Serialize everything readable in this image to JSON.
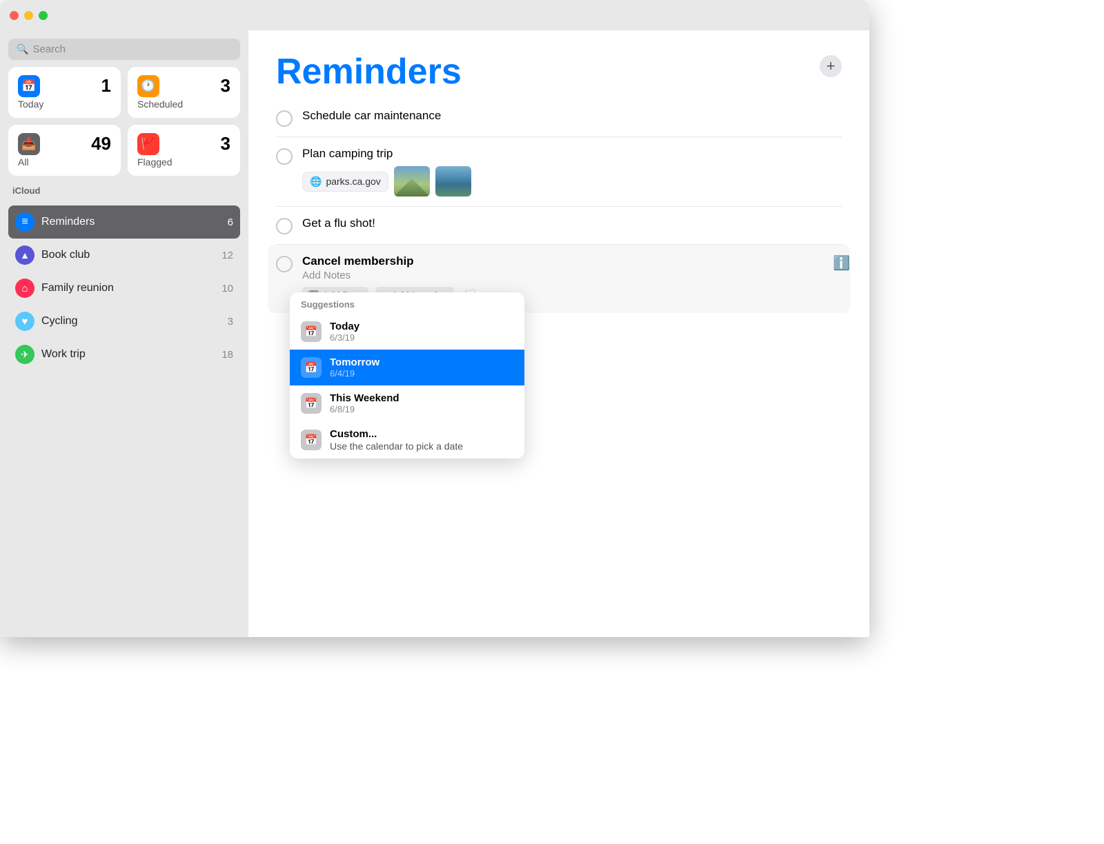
{
  "titlebar": {
    "lights": [
      "red",
      "yellow",
      "green"
    ]
  },
  "sidebar": {
    "search_placeholder": "Search",
    "tiles": [
      {
        "id": "today",
        "label": "Today",
        "count": "1",
        "icon": "📅",
        "icon_style": "blue"
      },
      {
        "id": "scheduled",
        "label": "Scheduled",
        "count": "3",
        "icon": "🕐",
        "icon_style": "orange"
      },
      {
        "id": "all",
        "label": "All",
        "count": "49",
        "icon": "📥",
        "icon_style": "gray"
      },
      {
        "id": "flagged",
        "label": "Flagged",
        "count": "3",
        "icon": "🚩",
        "icon_style": "red"
      }
    ],
    "section_label": "iCloud",
    "lists": [
      {
        "id": "reminders",
        "name": "Reminders",
        "count": "6",
        "icon_style": "li-blue",
        "icon": "≡",
        "active": true
      },
      {
        "id": "bookclub",
        "name": "Book club",
        "count": "12",
        "icon_style": "li-purple",
        "icon": "▲"
      },
      {
        "id": "familyreunion",
        "name": "Family reunion",
        "count": "10",
        "icon_style": "li-pink",
        "icon": "⌂"
      },
      {
        "id": "cycling",
        "name": "Cycling",
        "count": "3",
        "icon_style": "li-lightblue",
        "icon": "♥"
      },
      {
        "id": "worktrip",
        "name": "Work trip",
        "count": "18",
        "icon_style": "li-green",
        "icon": "✈"
      }
    ]
  },
  "main": {
    "title": "Reminders",
    "add_button_label": "+",
    "reminders": [
      {
        "id": "r1",
        "title": "Schedule car maintenance",
        "notes": "",
        "attachments": []
      },
      {
        "id": "r2",
        "title": "Plan camping trip",
        "notes": "",
        "attachments": [
          "link",
          "thumb1",
          "thumb2"
        ]
      },
      {
        "id": "r3",
        "title": "Get a flu shot!",
        "notes": "",
        "attachments": []
      },
      {
        "id": "r4",
        "title": "Cancel membership",
        "notes": "Add Notes",
        "editing": true,
        "attachments": []
      }
    ],
    "add_date_label": "Add Date",
    "add_location_label": "Add Location",
    "link_text": "parks.ca.gov",
    "suggestions": {
      "header": "Suggestions",
      "items": [
        {
          "id": "today",
          "day": "Today",
          "date": "6/3/19",
          "selected": false
        },
        {
          "id": "tomorrow",
          "day": "Tomorrow",
          "date": "6/4/19",
          "selected": true
        },
        {
          "id": "weekend",
          "day": "This Weekend",
          "date": "6/8/19",
          "selected": false
        },
        {
          "id": "custom",
          "day": "Custom...",
          "date": "",
          "desc": "Use the calendar to pick a date",
          "selected": false
        }
      ]
    }
  }
}
